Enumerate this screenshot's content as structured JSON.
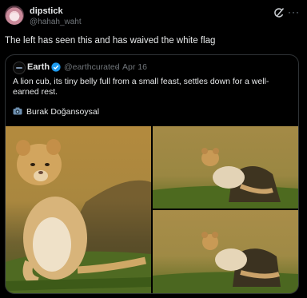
{
  "post": {
    "display_name": "dipstick",
    "handle": "@hahah_waht",
    "more_label": "···",
    "text": "The left has seen this and has waived the white flag"
  },
  "quoted_post": {
    "display_name": "Earth",
    "handle": "@earthcurated",
    "separator": "·",
    "date": "Apr 16",
    "text": "A lion cub, its tiny belly full from a small feast, settles down for a well-earned rest.",
    "credit": "Burak Doğansoysal"
  },
  "icons": [
    "avatar",
    "grok-icon",
    "more-icon",
    "verified-icon",
    "camera-icon"
  ],
  "colors": {
    "background": "#000000",
    "text": "#e7e9ea",
    "secondary_text": "#71767b",
    "border": "#2f3336",
    "verified": "#1d9bf0"
  }
}
